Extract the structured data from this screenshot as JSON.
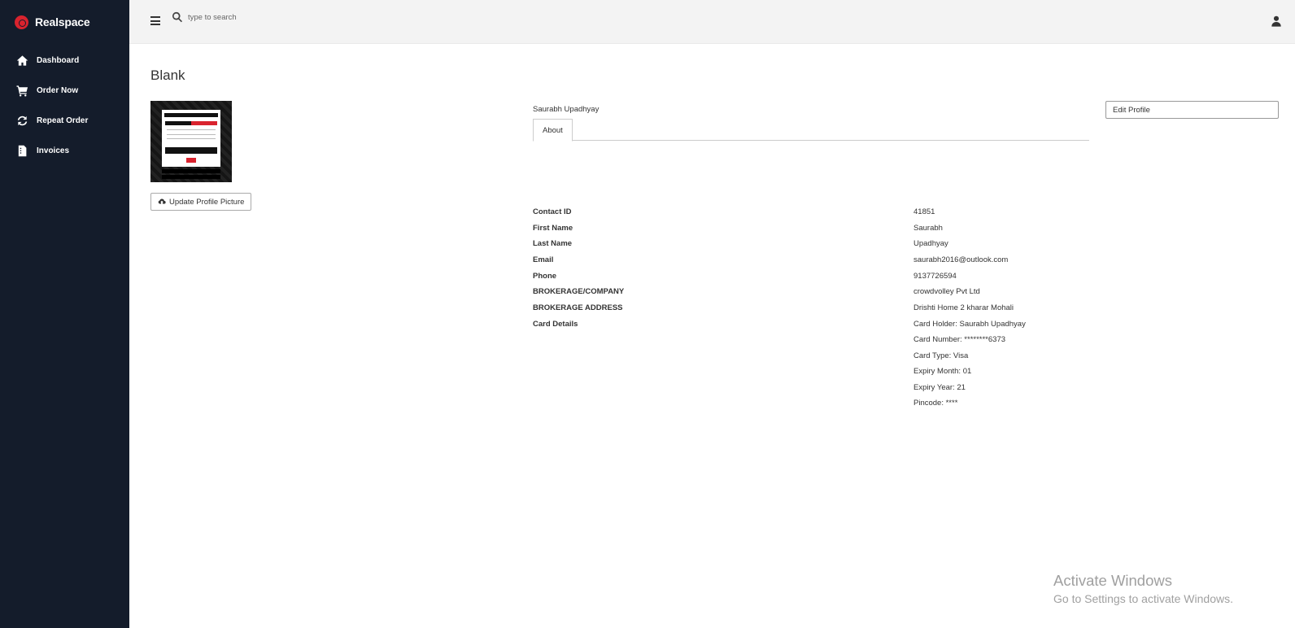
{
  "app": {
    "name": "Realspace"
  },
  "sidebar": {
    "items": [
      {
        "label": "Dashboard",
        "icon": "home-icon"
      },
      {
        "label": "Order Now",
        "icon": "cart-icon"
      },
      {
        "label": "Repeat Order",
        "icon": "refresh-icon"
      },
      {
        "label": "Invoices",
        "icon": "invoice-icon"
      }
    ]
  },
  "header": {
    "search_placeholder": "type to search"
  },
  "page": {
    "title": "Blank",
    "update_picture_label": "Update Profile Picture",
    "profile_name": "Saurabh Upadhyay",
    "tab_about": "About",
    "edit_profile_label": "Edit Profile"
  },
  "details": [
    {
      "label": "Contact ID",
      "value": "41851"
    },
    {
      "label": "First Name",
      "value": "Saurabh"
    },
    {
      "label": "Last Name",
      "value": "Upadhyay"
    },
    {
      "label": "Email",
      "value": "saurabh2016@outlook.com"
    },
    {
      "label": "Phone",
      "value": "9137726594"
    },
    {
      "label": "BROKERAGE/COMPANY",
      "value": "crowdvolley Pvt Ltd"
    },
    {
      "label": "BROKERAGE ADDRESS",
      "value": "Drishti Home 2 kharar Mohali"
    },
    {
      "label": "Card Details",
      "value": "Card Holder: Saurabh Upadhyay"
    }
  ],
  "card_lines": [
    "Card Number: ********6373",
    "Card Type: Visa",
    "Expiry Month: 01",
    "Expiry Year: 21",
    "Pincode: ****"
  ],
  "watermark": {
    "title": "Activate Windows",
    "subtitle": "Go to Settings to activate Windows."
  },
  "colors": {
    "sidebar_bg": "#141c2b",
    "brand_red": "#d9232e",
    "header_bg": "#f3f3f3"
  }
}
